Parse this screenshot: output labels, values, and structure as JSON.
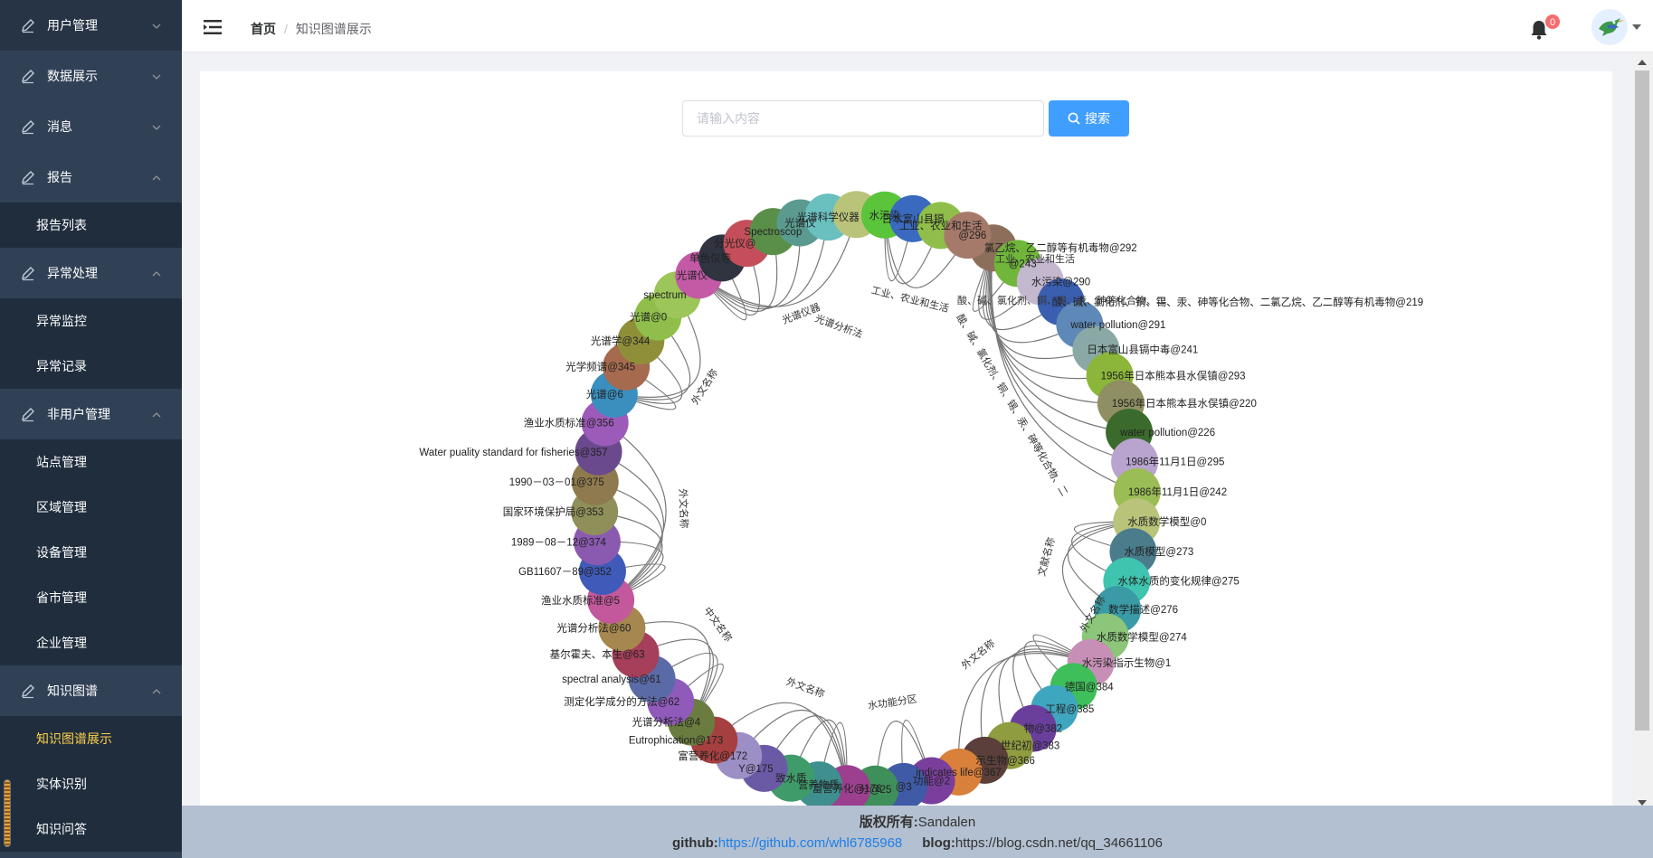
{
  "sidebar": {
    "menus": [
      {
        "label": "用户管理",
        "expanded": false,
        "children": []
      },
      {
        "label": "数据展示",
        "expanded": false,
        "children": []
      },
      {
        "label": "消息",
        "expanded": false,
        "children": []
      },
      {
        "label": "报告",
        "expanded": true,
        "children": [
          "报告列表"
        ]
      },
      {
        "label": "异常处理",
        "expanded": true,
        "children": [
          "异常监控",
          "异常记录"
        ]
      },
      {
        "label": "非用户管理",
        "expanded": true,
        "children": [
          "站点管理",
          "区域管理",
          "设备管理",
          "省市管理",
          "企业管理"
        ]
      },
      {
        "label": "知识图谱",
        "expanded": true,
        "children": [
          "知识图谱展示",
          "实体识别",
          "知识问答"
        ]
      }
    ],
    "active_item": "知识图谱展示",
    "active_color": "#ffd04b",
    "bg_color": "#304156"
  },
  "header": {
    "breadcrumb": [
      "首页",
      "知识图谱展示"
    ],
    "breadcrumb_separator": "/",
    "notification_count": "0",
    "icons": [
      "hamburger-icon",
      "bell-icon",
      "avatar-bird-icon",
      "caret-down-icon"
    ]
  },
  "search": {
    "placeholder": "请输入内容",
    "value": "",
    "button_label": "搜索",
    "button_color": "#409eff"
  },
  "graph": {
    "nodes": [
      {
        "label": "氯乙烷、乙二醇等有机毒物@292",
        "color": "#8b6f5a"
      },
      {
        "label": "@243",
        "color": "#6fb63a"
      },
      {
        "label": "水污染@290",
        "color": "#c4b8cf"
      },
      {
        "label": "酸、碱、氯化剂、铜、锡、汞、砷等化合物、二氯乙烷、乙二醇等有机毒物@219",
        "color": "#3a5fb0"
      },
      {
        "label": "water pollution@291",
        "color": "#5e88b8"
      },
      {
        "label": "日本富山县镉中毒@241",
        "color": "#8aa9a6"
      },
      {
        "label": "1956年日本熊本县水俣镇@293",
        "color": "#8bb63a"
      },
      {
        "label": "1956年日本熊本县水俣镇@220",
        "color": "#8f8f63"
      },
      {
        "label": "water pollution@226",
        "color": "#3a6a2c"
      },
      {
        "label": "1986年11月1日@295",
        "color": "#b9a4cf"
      },
      {
        "label": "1986年11月1日@242",
        "color": "#9bbd55"
      },
      {
        "label": "水质数学模型@0",
        "color": "#b9c37a"
      },
      {
        "label": "水质模型@273",
        "color": "#4a7c8c"
      },
      {
        "label": "水体水质的变化规律@275",
        "color": "#3fc4b0"
      },
      {
        "label": "数学描述@276",
        "color": "#3a9aa6"
      },
      {
        "label": "水质数学模型@274",
        "color": "#8bc67a"
      },
      {
        "label": "水污染指示生物@1",
        "color": "#c88fb6"
      },
      {
        "label": "德国@384",
        "color": "#3fbf5a"
      },
      {
        "label": "工程@385",
        "color": "#3fa6bf"
      },
      {
        "label": "物@382",
        "color": "#6a3f9c"
      },
      {
        "label": "世纪初@383",
        "color": "#8f9c3f"
      },
      {
        "label": "示生物@366",
        "color": "#5a3f3a"
      },
      {
        "label": "indicates life@367",
        "color": "#d9803a"
      },
      {
        "label": "功能@2",
        "color": "#7a3f9c"
      },
      {
        "label": "@3",
        "color": "#3f5aa6"
      },
      {
        "label": "分@25",
        "color": "#3f8f5a"
      },
      {
        "label": "富营养化@176",
        "color": "#9c3f8f"
      },
      {
        "label": "营养物质",
        "color": "#3f8f8f"
      },
      {
        "label": "致水质",
        "color": "#3f9c6a"
      },
      {
        "label": "Y@175",
        "color": "#6a5aa6"
      },
      {
        "label": "富营养化@172",
        "color": "#9c8fc6"
      },
      {
        "label": "Eutrophication@173",
        "color": "#a63f3f"
      },
      {
        "label": "光谱分析法@4",
        "color": "#6a7c3f"
      },
      {
        "label": "测定化学成分的方法@62",
        "color": "#8f5ab9"
      },
      {
        "label": "spectral analysis@61",
        "color": "#5a6aa6"
      },
      {
        "label": "基尔霍夫、本生@63",
        "color": "#a63f5a"
      },
      {
        "label": "光谱分析法@60",
        "color": "#a6874f"
      },
      {
        "label": "渔业水质标准@5",
        "color": "#c4589c"
      },
      {
        "label": "GB11607－89@352",
        "color": "#3f5ab9"
      },
      {
        "label": "1989－08－12@374",
        "color": "#8a5ab0"
      },
      {
        "label": "国家环境保护局@353",
        "color": "#8f8f5a"
      },
      {
        "label": "1990－03－01@375",
        "color": "#8f7a4f"
      },
      {
        "label": "Water puality standard for fisheries@357",
        "color": "#6a4a8c"
      },
      {
        "label": "渔业水质标准@356",
        "color": "#9c5ab9"
      },
      {
        "label": "光谱@6",
        "color": "#3a8fbf"
      },
      {
        "label": "光学频谱@345",
        "color": "#a66a4f"
      },
      {
        "label": "光谱学@344",
        "color": "#8f8f3a"
      },
      {
        "label": "光谱@0",
        "color": "#8fbf4a"
      },
      {
        "label": "spectrum",
        "color": "#9cc65a"
      },
      {
        "label": "光谱仪",
        "color": "#c45aa6"
      },
      {
        "label": "单色仪等",
        "color": "#2f3440"
      },
      {
        "label": "分光仪@",
        "color": "#c44f5a"
      },
      {
        "label": "Spectroscop",
        "color": "#5a8f4a"
      },
      {
        "label": "光谱仪",
        "color": "#5a9a8f"
      },
      {
        "label": "光谱科学仪器",
        "color": "#6abfbf"
      },
      {
        "label": "",
        "color": "#b9c47a"
      },
      {
        "label": "水污染",
        "color": "#5ac43a"
      },
      {
        "label": "日本富山县镉",
        "color": "#3a6abf"
      },
      {
        "label": "工业、农业和生活",
        "color": "#8fbf4a"
      },
      {
        "label": "@296",
        "color": "#a67a6a"
      }
    ],
    "inner_texts": [
      "酸、碱、氯化剂、铜、锡、汞、砷等化合物、二",
      "酸、碱、氯化剂、铜、锡、汞、砷等化合物、二",
      "工业、农业和生活",
      "光谱仪器",
      "光谱分析法",
      "外文名称",
      "外文名称",
      "中文名称",
      "外文名称",
      "水功能分区",
      "外文名称",
      "外文名称",
      "文献名称"
    ]
  },
  "footer": {
    "copyright_label": "版权所有:",
    "copyright_owner": "Sandalen",
    "github_label": "github:",
    "github_url": "https://github.com/whl6785968",
    "blog_label": "blog:",
    "blog_url": "https://blog.csdn.net/qq_34661106"
  }
}
